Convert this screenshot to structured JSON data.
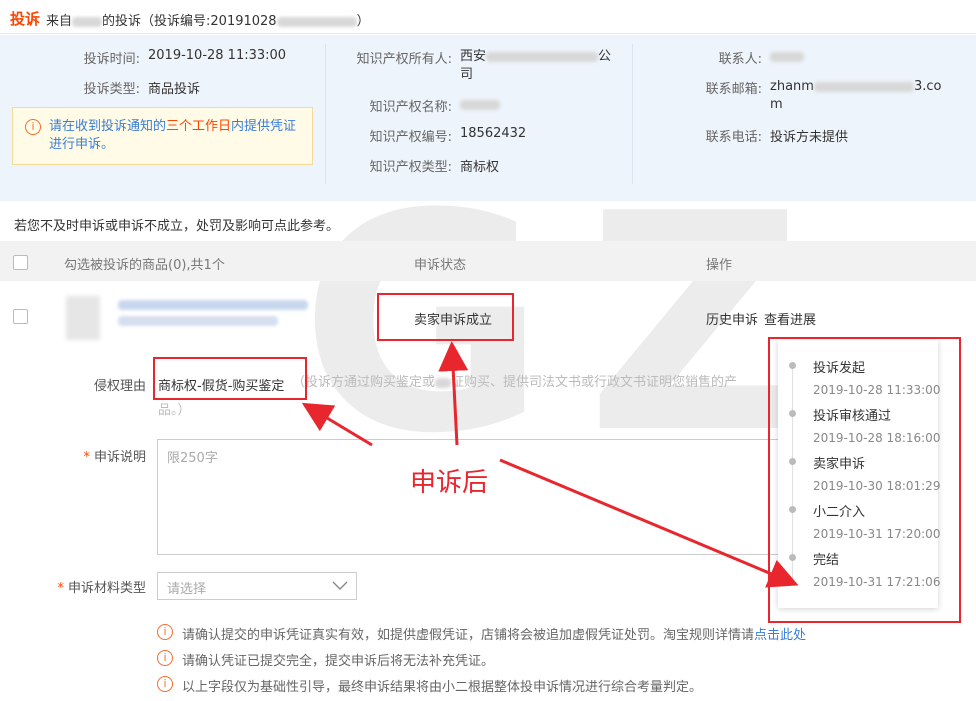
{
  "header": {
    "title": "投诉",
    "from_prefix": "来自",
    "from_suffix": "的投诉",
    "complaint_no_prefix": "（投诉编号:20191028",
    "complaint_no_suffix": "）"
  },
  "info": {
    "time_label": "投诉时间:",
    "time_value": "2019-10-28 11:33:00",
    "type_label": "投诉类型:",
    "type_value": "商品投诉",
    "ip_owner_label": "知识产权所有人:",
    "ip_owner_value_line1": "西安",
    "ip_owner_value_tail": "公",
    "ip_owner_value_line2": "司",
    "ip_name_label": "知识产权名称:",
    "ip_name_value": "",
    "ip_no_label": "知识产权编号:",
    "ip_no_value": "18562432",
    "ip_type_label": "知识产权类型:",
    "ip_type_value": "商标权",
    "contact_label": "联系人:",
    "contact_value": "",
    "email_label": "联系邮箱:",
    "email_value_line1_start": "zhanm",
    "email_value_line1_end": "3.co",
    "email_value_line2": "m",
    "phone_label": "联系电话:",
    "phone_value": "投诉方未提供"
  },
  "notice": {
    "icon": "info-circle-icon",
    "text_before": "请在收到投诉通知的",
    "text_highlight": "三个工作日",
    "text_after": "内提供凭证进行申诉。"
  },
  "reference_text": "若您不及时申诉或申诉不成立，处罚及影响可点此参考。",
  "table": {
    "col_product": "勾选被投诉的商品(0),共1个",
    "col_status": "申诉状态",
    "col_action": "操作",
    "row_status": "卖家申诉成立",
    "row_history": "历史申诉",
    "row_progress": "查看进展"
  },
  "form": {
    "reason_label": "侵权理由",
    "reason_value": "商标权-假货-购买鉴定",
    "reason_hint_line1": "（投诉方通过购买鉴定或",
    "reason_hint_line1b": "证购买、提供司法文书或行政文书证明您销售的产",
    "reason_hint_line2": "品。）",
    "desc_label": "申诉说明",
    "desc_placeholder": "限250字",
    "material_label": "申诉材料类型",
    "material_placeholder": "请选择",
    "required_mark": "*"
  },
  "tips": [
    {
      "text": "请确认提交的申诉凭证真实有效，如提供虚假凭证，店铺将会被追加虚假凭证处罚。淘宝规则详情请",
      "link": "点击此处"
    },
    {
      "text": "请确认凭证已提交完全，提交申诉后将无法补充凭证。",
      "link": ""
    },
    {
      "text": "以上字段仅为基础性引导，最终申诉结果将由小二根据整体投申诉情况进行综合考量判定。",
      "link": ""
    }
  ],
  "timeline": [
    {
      "title": "投诉发起",
      "time": "2019-10-28 11:33:00"
    },
    {
      "title": "投诉审核通过",
      "time": "2019-10-28 18:16:00"
    },
    {
      "title": "卖家申诉",
      "time": "2019-10-30 18:01:29"
    },
    {
      "title": "小二介入",
      "time": "2019-10-31 17:20:00"
    },
    {
      "title": "完结",
      "time": "2019-10-31 17:21:06"
    }
  ],
  "annotation": {
    "label": "申诉后"
  },
  "watermark": "GZ",
  "colors": {
    "accent_red": "#e8262d",
    "brand_orange": "#ff4400",
    "link_blue": "#3a7dd8",
    "panel_bg": "#eef4fb"
  }
}
